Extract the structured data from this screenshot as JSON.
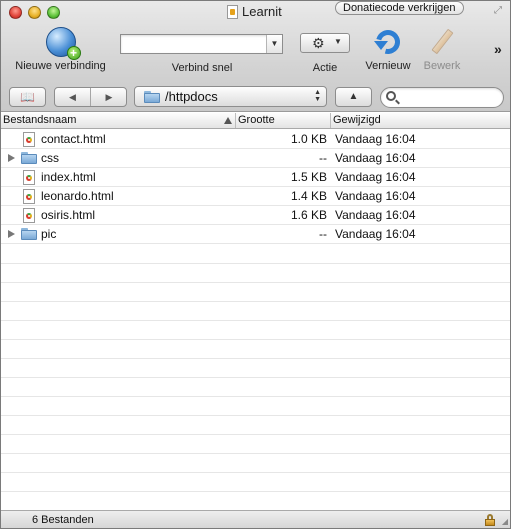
{
  "window": {
    "title": "Learnit"
  },
  "donate_label": "Donatiecode verkrijgen",
  "toolbar": {
    "new_connection": "Nieuwe verbinding",
    "quick_connect": "Verbind snel",
    "quick_connect_value": "",
    "action": "Actie",
    "refresh": "Vernieuw",
    "edit": "Bewerk"
  },
  "path": {
    "current": "/httpdocs"
  },
  "search": {
    "placeholder": ""
  },
  "columns": {
    "name": "Bestandsnaam",
    "size": "Grootte",
    "modified": "Gewijzigd"
  },
  "files": [
    {
      "name": "contact.html",
      "size": "1.0 KB",
      "modified": "Vandaag 16:04",
      "type": "html"
    },
    {
      "name": "css",
      "size": "--",
      "modified": "Vandaag 16:04",
      "type": "folder"
    },
    {
      "name": "index.html",
      "size": "1.5 KB",
      "modified": "Vandaag 16:04",
      "type": "html"
    },
    {
      "name": "leonardo.html",
      "size": "1.4 KB",
      "modified": "Vandaag 16:04",
      "type": "html"
    },
    {
      "name": "osiris.html",
      "size": "1.6 KB",
      "modified": "Vandaag 16:04",
      "type": "html"
    },
    {
      "name": "pic",
      "size": "--",
      "modified": "Vandaag 16:04",
      "type": "folder"
    }
  ],
  "status": {
    "count_text": "6 Bestanden"
  },
  "icons": {
    "new_connection": "globe-plus-icon",
    "action": "gear-icon",
    "refresh": "refresh-icon",
    "edit": "pencil-icon",
    "bookmarks": "book-icon",
    "search": "search-icon",
    "lock": "lock-icon"
  }
}
